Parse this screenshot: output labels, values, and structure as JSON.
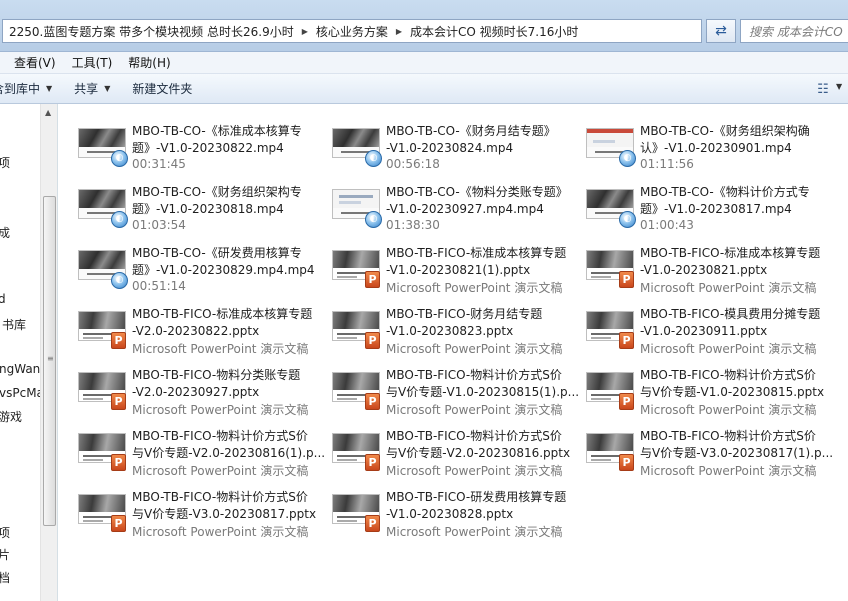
{
  "address": {
    "crumbs": [
      "2250.蓝图专题方案 带多个模块视频 总时长26.9小时",
      "核心业务方案",
      "成本会计CO 视频时长7.16小时"
    ],
    "search_placeholder": "搜索 成本会计CO"
  },
  "menu": [
    "查看(V)",
    "工具(T)",
    "帮助(H)"
  ],
  "toolbar": {
    "library": "含到库中",
    "share": "共享",
    "new_folder": "新建文件夹"
  },
  "nav": [
    "项",
    "成",
    "d",
    "书库",
    "ngWan",
    "vsPcMa",
    "游戏",
    "项",
    "片",
    "档"
  ],
  "files": [
    {
      "line1": "MBO-TB-CO-《标准成本核算专",
      "line2": "题》-V1.0-20230822.mp4",
      "sub": "00:31:45",
      "type": "video"
    },
    {
      "line1": "MBO-TB-CO-《财务月结专题》",
      "line2": "-V1.0-20230824.mp4",
      "sub": "00:56:18",
      "type": "video"
    },
    {
      "line1": "MBO-TB-CO-《财务组织架构确",
      "line2": "认》-V1.0-20230901.mp4",
      "sub": "01:11:56",
      "type": "video"
    },
    {
      "line1": "MBO-TB-CO-《财务组织架构专",
      "line2": "题》-V1.0-20230818.mp4",
      "sub": "01:03:54",
      "type": "video"
    },
    {
      "line1": "MBO-TB-CO-《物料分类账专题》",
      "line2": "-V1.0-20230927.mp4.mp4",
      "sub": "01:38:30",
      "type": "video"
    },
    {
      "line1": "MBO-TB-CO-《物料计价方式专",
      "line2": "题》-V1.0-20230817.mp4",
      "sub": "01:00:43",
      "type": "video"
    },
    {
      "line1": "MBO-TB-CO-《研发费用核算专",
      "line2": "题》-V1.0-20230829.mp4.mp4",
      "sub": "00:51:14",
      "type": "video"
    },
    {
      "line1": "MBO-TB-FICO-标准成本核算专题",
      "line2": "-V1.0-20230821(1).pptx",
      "sub": "Microsoft PowerPoint 演示文稿",
      "type": "ppt"
    },
    {
      "line1": "MBO-TB-FICO-标准成本核算专题",
      "line2": "-V1.0-20230821.pptx",
      "sub": "Microsoft PowerPoint 演示文稿",
      "type": "ppt"
    },
    {
      "line1": "MBO-TB-FICO-标准成本核算专题",
      "line2": "-V2.0-20230822.pptx",
      "sub": "Microsoft PowerPoint 演示文稿",
      "type": "ppt"
    },
    {
      "line1": "MBO-TB-FICO-财务月结专题",
      "line2": "-V1.0-20230823.pptx",
      "sub": "Microsoft PowerPoint 演示文稿",
      "type": "ppt"
    },
    {
      "line1": "MBO-TB-FICO-模具费用分摊专题",
      "line2": "-V1.0-20230911.pptx",
      "sub": "Microsoft PowerPoint 演示文稿",
      "type": "ppt"
    },
    {
      "line1": "MBO-TB-FICO-物料分类账专题",
      "line2": "-V2.0-20230927.pptx",
      "sub": "Microsoft PowerPoint 演示文稿",
      "type": "ppt"
    },
    {
      "line1": "MBO-TB-FICO-物料计价方式S价",
      "line2": "与V价专题-V1.0-20230815(1).p...",
      "sub": "Microsoft PowerPoint 演示文稿",
      "type": "ppt"
    },
    {
      "line1": "MBO-TB-FICO-物料计价方式S价",
      "line2": "与V价专题-V1.0-20230815.pptx",
      "sub": "Microsoft PowerPoint 演示文稿",
      "type": "ppt"
    },
    {
      "line1": "MBO-TB-FICO-物料计价方式S价",
      "line2": "与V价专题-V2.0-20230816(1).p...",
      "sub": "Microsoft PowerPoint 演示文稿",
      "type": "ppt"
    },
    {
      "line1": "MBO-TB-FICO-物料计价方式S价",
      "line2": "与V价专题-V2.0-20230816.pptx",
      "sub": "Microsoft PowerPoint 演示文稿",
      "type": "ppt"
    },
    {
      "line1": "MBO-TB-FICO-物料计价方式S价",
      "line2": "与V价专题-V3.0-20230817(1).p...",
      "sub": "Microsoft PowerPoint 演示文稿",
      "type": "ppt"
    },
    {
      "line1": "MBO-TB-FICO-物料计价方式S价",
      "line2": "与V价专题-V3.0-20230817.pptx",
      "sub": "Microsoft PowerPoint 演示文稿",
      "type": "ppt"
    },
    {
      "line1": "MBO-TB-FICO-研发费用核算专题",
      "line2": "-V1.0-20230828.pptx",
      "sub": "Microsoft PowerPoint 演示文稿",
      "type": "ppt"
    }
  ]
}
